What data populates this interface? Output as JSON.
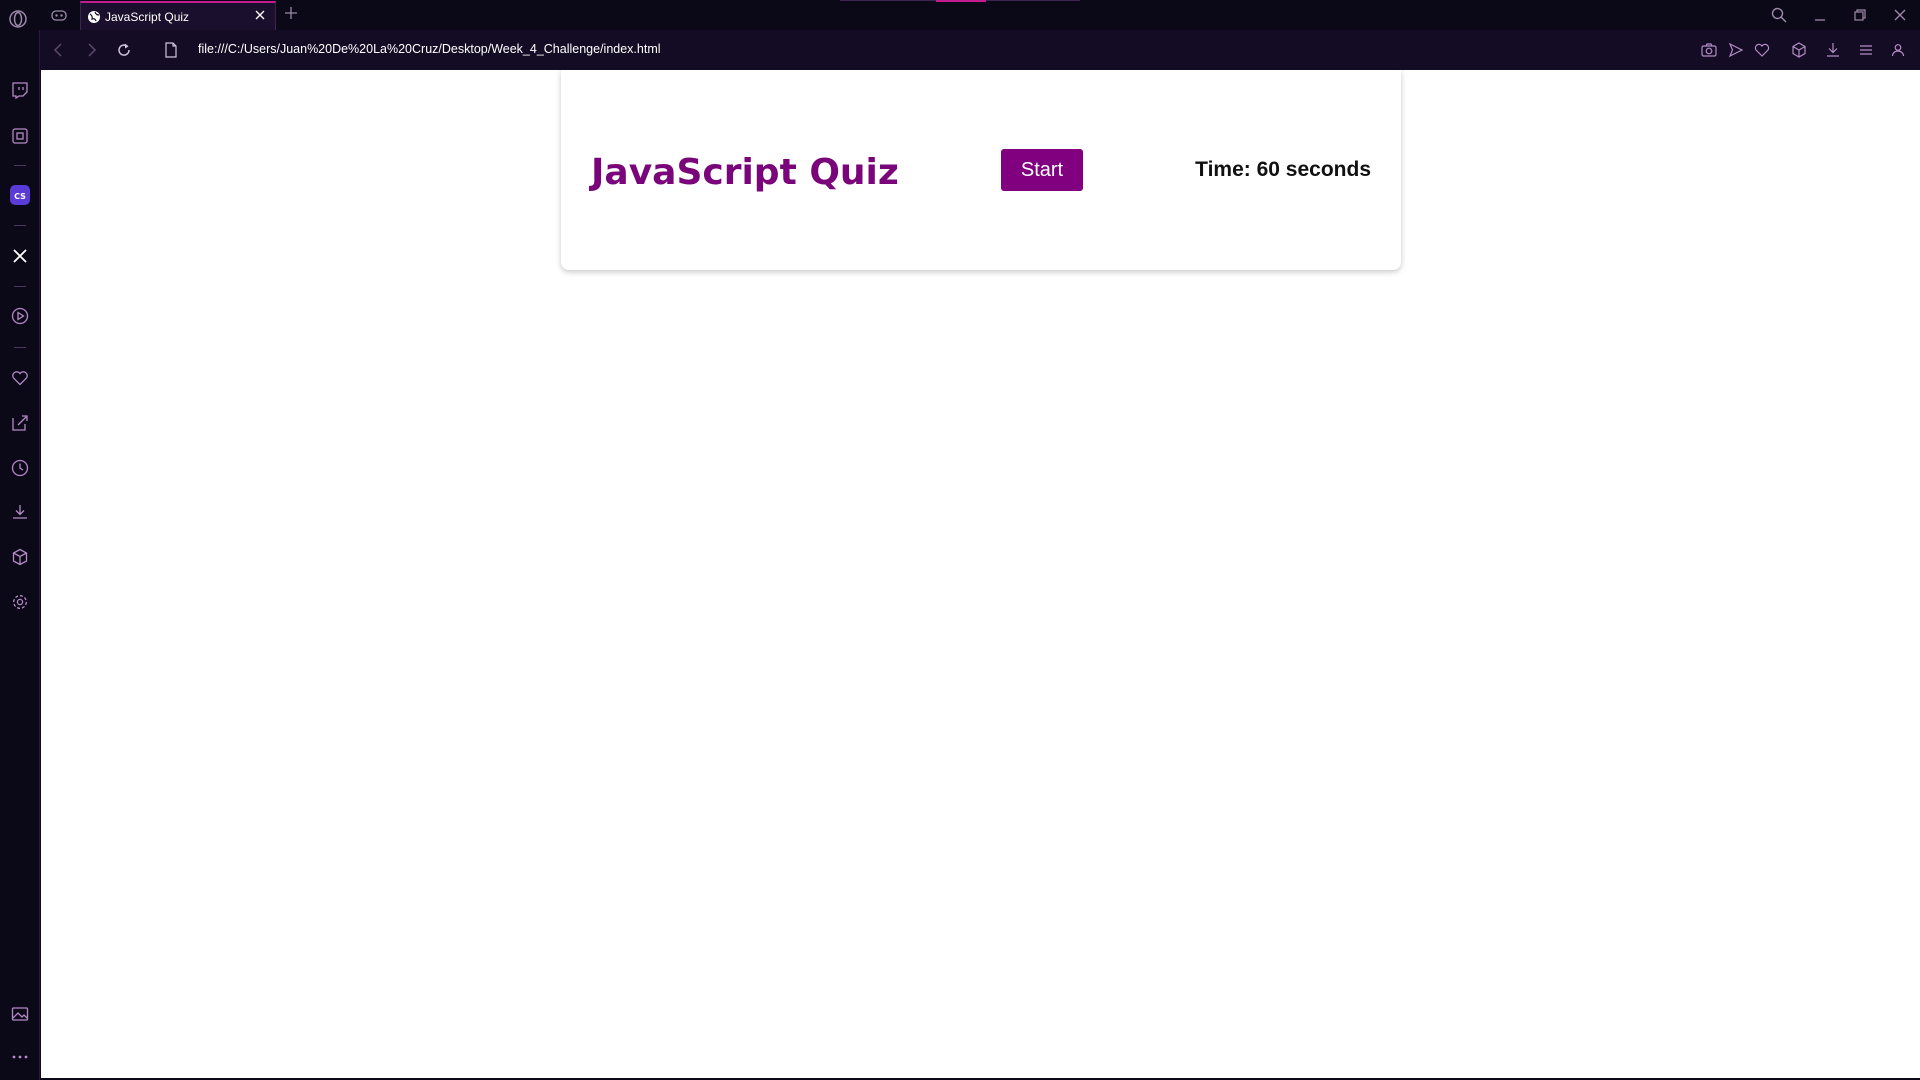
{
  "browser": {
    "tab": {
      "title": "JavaScript Quiz"
    },
    "address_bar": {
      "url": "file:///C:/Users/Juan%20De%20La%20Cruz/Desktop/Week_4_Challenge/index.html"
    },
    "colors": {
      "chrome_bg": "#0b0818",
      "accent": "#c21a8f",
      "icon": "#b38bc4"
    },
    "sidebar_icons": [
      "twitch-icon",
      "wallet-icon",
      "cs-app-icon",
      "x-icon",
      "player-icon",
      "heart-icon",
      "pinboard-icon",
      "history-icon",
      "downloads-icon",
      "extensions-icon",
      "settings-icon",
      "gallery-icon",
      "more-icon"
    ],
    "toolbar_icons": [
      "camera-icon",
      "send-icon",
      "heart-icon",
      "cube-icon",
      "download-icon",
      "menu-icon",
      "profile-icon"
    ]
  },
  "page": {
    "quiz": {
      "title": "JavaScript Quiz",
      "start_label": "Start",
      "timer_text": "Time: 60 seconds"
    },
    "colors": {
      "title": "#7a057a",
      "button": "#800080"
    }
  }
}
